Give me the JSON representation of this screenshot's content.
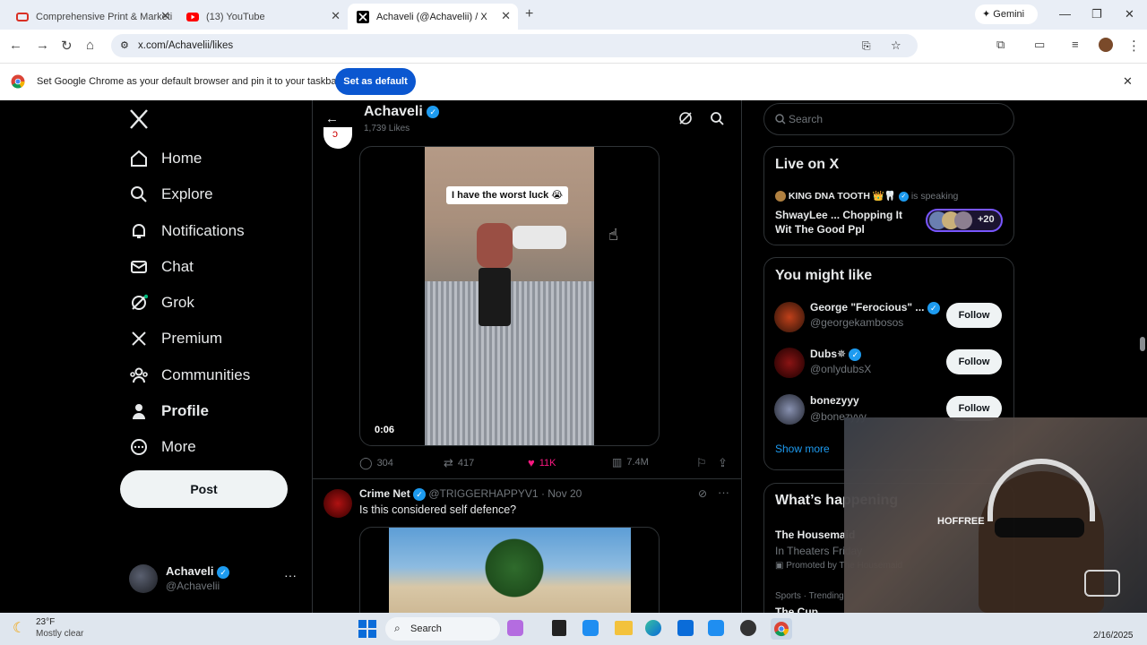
{
  "browser": {
    "tabs": [
      {
        "title": "Comprehensive Print & Marketi"
      },
      {
        "title": "(13) YouTube"
      },
      {
        "title": "Achaveli (@Achavelii) / X"
      }
    ],
    "gemini_label": "Gemini",
    "url": "x.com/Achavelii/likes",
    "infobar_text": "Set Google Chrome as your default browser and pin it to your taskbar",
    "set_default_label": "Set as default"
  },
  "sidebar": {
    "items": [
      {
        "label": "Home",
        "icon": "home-icon"
      },
      {
        "label": "Explore",
        "icon": "search-icon"
      },
      {
        "label": "Notifications",
        "icon": "bell-icon"
      },
      {
        "label": "Chat",
        "icon": "mail-icon"
      },
      {
        "label": "Grok",
        "icon": "grok-icon"
      },
      {
        "label": "Premium",
        "icon": "x-logo-icon"
      },
      {
        "label": "Communities",
        "icon": "people-icon"
      },
      {
        "label": "Profile",
        "icon": "person-icon"
      },
      {
        "label": "More",
        "icon": "more-circle-icon"
      }
    ],
    "post_label": "Post",
    "account": {
      "name": "Achaveli",
      "handle": "@Achavelii"
    }
  },
  "header": {
    "name": "Achaveli",
    "subtitle": "1,739 Likes"
  },
  "post1": {
    "caption": "I have the worst luck 😭",
    "duration": "0:06",
    "replies": "304",
    "reposts": "417",
    "likes": "11K",
    "views": "7.4M"
  },
  "post2": {
    "author": "Crime Net",
    "handle": "@TRIGGERHAPPYV1",
    "date": "· Nov 20",
    "text": "Is this considered self defence?"
  },
  "search": {
    "placeholder": "Search"
  },
  "live": {
    "title": "Live on X",
    "host": "KING DNA TOOTH 👑🦷",
    "status": "is speaking",
    "space_title": "ShwayLee ... Chopping It Wit The Good Ppl",
    "listeners": "+20"
  },
  "might_like": {
    "title": "You might like",
    "users": [
      {
        "name": "George \"Ferocious\" ...",
        "handle": "@georgekambosos",
        "follow": "Follow"
      },
      {
        "name": "Dubs✵",
        "handle": "@onlydubsX",
        "follow": "Follow"
      },
      {
        "name": "bonezyyy",
        "handle": "@bonezyyy",
        "follow": "Follow"
      }
    ],
    "show_more": "Show more"
  },
  "happening": {
    "title": "What’s happening",
    "trend1_title": "The Housemaid",
    "trend1_sub": "In Theaters Friday",
    "trend1_promo": "Promoted by The Housemaid",
    "trend2_cat": "Sports · Trending",
    "trend2_title": "The Cup"
  },
  "overlay": {
    "shirt_text": "HOFFREE"
  },
  "taskbar": {
    "temp": "23°F",
    "weather": "Mostly clear",
    "search_label": "Search",
    "date": "2/16/2025"
  },
  "colors": {
    "x_blue": "#1d9bf0",
    "like_pink": "#f91880",
    "chrome_blue": "#0b57d0"
  }
}
